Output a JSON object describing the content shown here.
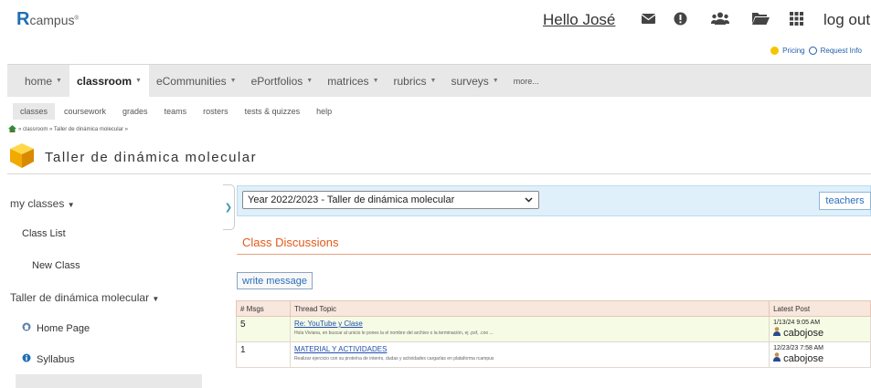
{
  "header": {
    "logo_r": "R",
    "logo_rest": "campus",
    "logo_mark": "®",
    "greeting": "Hello José",
    "logout": "log out",
    "icons": [
      "mail-icon",
      "alert-icon",
      "people-icon",
      "folder-icon",
      "grid-icon"
    ]
  },
  "utility": {
    "pricing": "Pricing",
    "request_info": "Request Info"
  },
  "mainnav": {
    "items": [
      {
        "label": "home",
        "caret": "▼"
      },
      {
        "label": "classroom",
        "caret": "▼"
      },
      {
        "label": "eCommunities",
        "caret": "▼"
      },
      {
        "label": "ePortfolios",
        "caret": "▼"
      },
      {
        "label": "matrices",
        "caret": "▼"
      },
      {
        "label": "rubrics",
        "caret": "▼"
      },
      {
        "label": "surveys",
        "caret": "▼"
      },
      {
        "label": "more...",
        "caret": ""
      }
    ]
  },
  "subnav": {
    "items": [
      "classes",
      "coursework",
      "grades",
      "teams",
      "rosters",
      "tests & quizzes",
      "help"
    ]
  },
  "breadcrumb": {
    "text": "» classroom » Taller de dinámica molecular »"
  },
  "page": {
    "title": "Taller de dinámica molecular"
  },
  "sidebar": {
    "my_classes": "my classes",
    "class_list": "Class List",
    "new_class": "New Class",
    "current_class": "Taller de dinámica molecular",
    "caret": "▼",
    "home_page": "Home Page",
    "syllabus": "Syllabus"
  },
  "classbar": {
    "selected": "Year 2022/2023 - Taller de dinámica molecular",
    "teachers": "teachers"
  },
  "discussions": {
    "title": "Class Discussions",
    "write_message": "write message",
    "columns": [
      "# Msgs",
      "Thread Topic",
      "Latest Post"
    ],
    "rows": [
      {
        "count": "5",
        "topic": "Re: YouTube y Clase",
        "snippet": "Hola Viviana, en buscar al unicio le pones la el nombre del archivo o la terminación, ej .psf, .coo ...",
        "date": "1/13/24 9:05 AM",
        "user": "cabojose"
      },
      {
        "count": "1",
        "topic": "MATERIAL Y ACTIVIDADES",
        "snippet": "Realizar ejercicio con su proteína de interés, dudas y actividades cargarlas en plataforma rcampus",
        "date": "12/23/23 7:58 AM",
        "user": "cabojose"
      }
    ]
  },
  "colors": {
    "accent": "#e05a1a",
    "link": "#1f4fb0",
    "brand": "#1f6fb5"
  }
}
